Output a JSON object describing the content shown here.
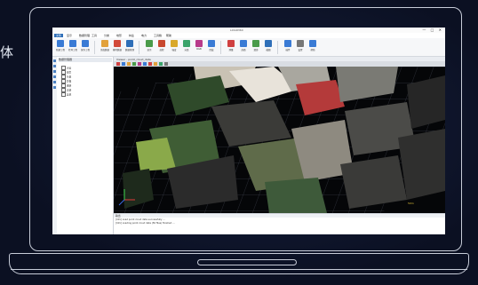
{
  "left_char": "体",
  "app": {
    "title": "LiDAR360",
    "window_controls": "— □ ✕",
    "menu": [
      {
        "label": "文件",
        "active": true
      },
      {
        "label": "显示"
      },
      {
        "label": "数据管理"
      },
      {
        "label": "工具"
      },
      {
        "label": "分类"
      },
      {
        "label": "地形"
      },
      {
        "label": "林业"
      },
      {
        "label": "电力"
      },
      {
        "label": "工具箱"
      },
      {
        "label": "帮助"
      }
    ],
    "ribbon": [
      {
        "label": "新建工程",
        "color": "#3a7bd5"
      },
      {
        "label": "打开工程",
        "color": "#3a7bd5"
      },
      {
        "label": "保存工程",
        "color": "#3a7bd5"
      },
      {
        "label": "添加数据",
        "color": "#e2a13a"
      },
      {
        "label": "移除数据",
        "color": "#d24a3a"
      },
      {
        "label": "数据管理",
        "color": "#2f6fb8"
      },
      {
        "label": "显示",
        "color": "#4a9b4a"
      },
      {
        "label": "高程",
        "color": "#c8482f"
      },
      {
        "label": "强度",
        "color": "#d9a82a"
      },
      {
        "label": "分类",
        "color": "#3aa36a"
      },
      {
        "label": "RGB",
        "color": "#b83a8a"
      },
      {
        "label": "回波",
        "color": "#3a7bd5"
      },
      {
        "label": "测量",
        "color": "#d04040"
      },
      {
        "label": "剖面",
        "color": "#3a7bd5"
      },
      {
        "label": "漫游",
        "color": "#4a9b4a"
      },
      {
        "label": "截图",
        "color": "#2f6fb8"
      },
      {
        "label": "插件",
        "color": "#3a7bd5"
      },
      {
        "label": "设置",
        "color": "#777777"
      },
      {
        "label": "帮助",
        "color": "#3a7bd5"
      }
    ],
    "side_panel": {
      "header": "数据管理器",
      "items": [
        "点云",
        "模型",
        "矢量",
        "影像",
        "栅格",
        "表格",
        "其他"
      ]
    },
    "viewport": {
      "tab": "Viewer - point_cloud_data",
      "scale": "50m"
    },
    "console": {
      "header": "输出",
      "lines": [
        "[Info] Load point cloud data successfully ...",
        "[Info] Loading point cloud data (56 files) finished ..."
      ]
    }
  }
}
